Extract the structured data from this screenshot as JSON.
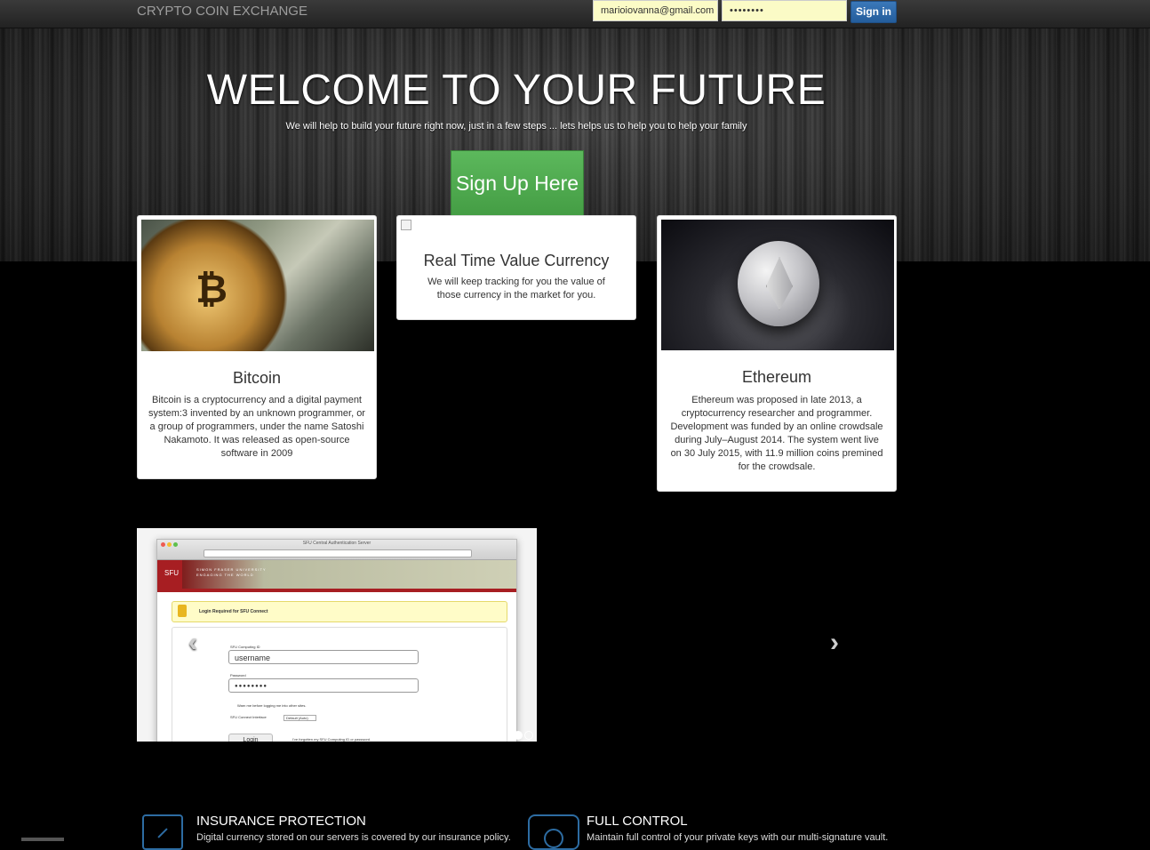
{
  "navbar": {
    "brand": "CRYPTO COIN EXCHANGE",
    "email_value": "marioiovanna@gmail.com",
    "password_value": "••••••••",
    "signin_label": "Sign in"
  },
  "hero": {
    "title": "WELCOME TO YOUR FUTURE",
    "subtitle": "We will help to build your future right now, just in a few steps ... lets helps us to help you to help your family",
    "signup_label": "Sign Up Here"
  },
  "cards": [
    {
      "title": "Bitcoin",
      "text": "Bitcoin is a cryptocurrency and a digital payment system:3 invented by an unknown programmer, or a group of programmers, under the name Satoshi Nakamoto. It was released as open-source software in 2009",
      "image_symbol": "₿"
    },
    {
      "title": "Real Time Value Currency",
      "text": "We will keep tracking for you the value of those currency in the market for you."
    },
    {
      "title": "Ethereum",
      "text": "Ethereum was proposed in late 2013, a cryptocurrency researcher and programmer. Development was funded by an online crowdsale during July–August 2014. The system went live on 30 July 2015, with 11.9 million coins premined for the crowdsale."
    }
  ],
  "carousel": {
    "prev_icon": "‹",
    "next_icon": "›",
    "slide": {
      "window_title": "SFU Central Authentication Server",
      "logo_text": "SFU",
      "university_name": "SIMON FRASER UNIVERSITY",
      "tagline": "ENGAGING THE WORLD",
      "warning_text": "Login Required for SFU Connect",
      "computing_id_label": "SFU Computing ID",
      "username_value": "username",
      "password_label": "Password",
      "password_value": "●●●●●●●●",
      "warn_checkbox_label": "Warn me before logging me into other sites.",
      "interface_label": "SFU Connect Interface",
      "interface_value": "Default (Auto)",
      "login_label": "Login",
      "forgot_text": "I've forgotten my SFU Computing ID or password."
    }
  },
  "features": [
    {
      "title": "INSURANCE PROTECTION",
      "text": "Digital currency stored on our servers is covered by our insurance policy."
    },
    {
      "title": "FULL CONTROL",
      "text": "Maintain full control of your private keys with our multi-signature vault."
    }
  ],
  "colors": {
    "signup_green": "#5cb85c",
    "signin_blue": "#2f6eb0",
    "input_yellow": "#fbfbc6",
    "feature_icon_blue": "#2d6ca2"
  }
}
